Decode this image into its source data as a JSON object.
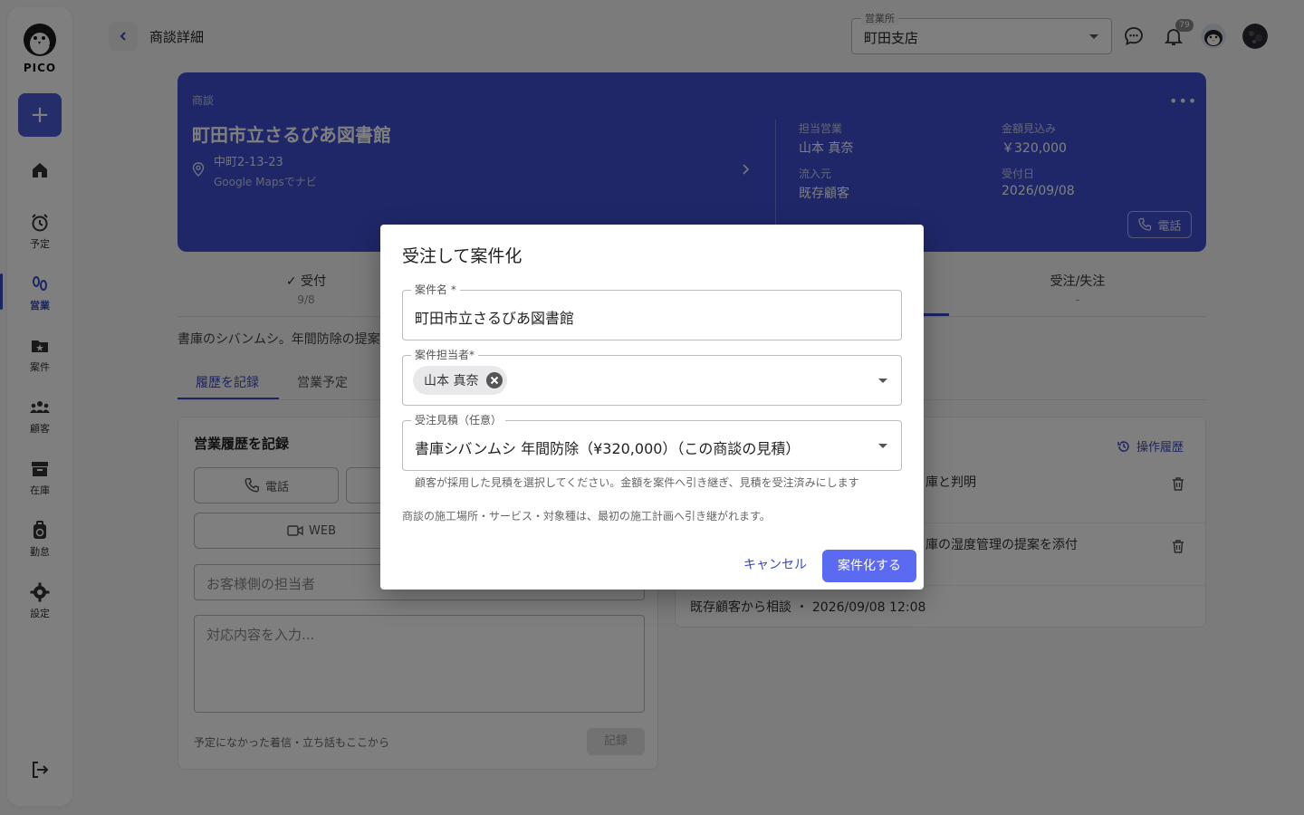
{
  "app": {
    "logo_text": "PICO"
  },
  "sidebar": {
    "items": [
      {
        "label": "",
        "icon": "home-icon"
      },
      {
        "label": "予定",
        "icon": "alarm-icon"
      },
      {
        "label": "営業",
        "icon": "footprints-icon",
        "active": true
      },
      {
        "label": "案件",
        "icon": "folder-star-icon"
      },
      {
        "label": "顧客",
        "icon": "people-icon"
      },
      {
        "label": "在庫",
        "icon": "archive-icon"
      },
      {
        "label": "勤怠",
        "icon": "timecard-icon"
      },
      {
        "label": "設定",
        "icon": "gear-icon"
      }
    ],
    "add_label": "+"
  },
  "header": {
    "title": "商談詳細",
    "branch_label": "営業所",
    "branch_value": "町田支店",
    "notification_count": "79"
  },
  "deal": {
    "type_label": "商談",
    "title": "町田市立さるびあ図書館",
    "address": "中町2-13-23",
    "maps_link": "Google Mapsでナビ",
    "sales_rep_label": "担当営業",
    "sales_rep": "山本 真奈",
    "amount_label": "金額見込み",
    "amount": "￥320,000",
    "source_label": "流入元",
    "source": "既存顧客",
    "received_label": "受付日",
    "received": "2026/09/08",
    "call_label": "電話"
  },
  "steps": [
    {
      "label": "✓ 受付",
      "sub": "9/8"
    },
    {
      "label": "受注/失注",
      "sub": "-"
    }
  ],
  "description": "書庫のシバンムシ。年間防除の提案",
  "tabs": [
    {
      "label": "履歴を記録",
      "active": true
    },
    {
      "label": "営業予定"
    }
  ],
  "record_panel": {
    "title": "営業履歴を記録",
    "channel_call": "電話",
    "channel_web": "WEB",
    "contact_placeholder": "お客様側の担当者",
    "content_placeholder": "対応内容を入力...",
    "hint": "予定になかった着信・立ち話もここから",
    "record_button": "記録"
  },
  "history_panel": {
    "op_history": "操作履歴",
    "entries": [
      {
        "text": "庫と判明"
      },
      {
        "text": "庫の湿度管理の提案を添付"
      },
      {
        "text": "既存顧客から相談 ・ 2026/09/08 12:08"
      }
    ]
  },
  "dialog": {
    "title": "受注して案件化",
    "project_name_label": "案件名 *",
    "project_name_value": "町田市立さるびあ図書館",
    "assignee_label": "案件担当者*",
    "assignee_chip": "山本 真奈",
    "estimate_label": "受注見積（任意）",
    "estimate_value": "書庫シバンムシ 年間防除（¥320,000）（この商談の見積）",
    "helper": "顧客が採用した見積を選択してください。金額を案件へ引き継ぎ、見積を受注済みにします",
    "note": "商談の施工場所・サービス・対象種は、最初の施工計画へ引き継がれます。",
    "cancel": "キャンセル",
    "confirm": "案件化する"
  },
  "colors": {
    "accent": "#3848c4",
    "card": "#3f4fd1",
    "primary_button": "#5b6af0"
  }
}
